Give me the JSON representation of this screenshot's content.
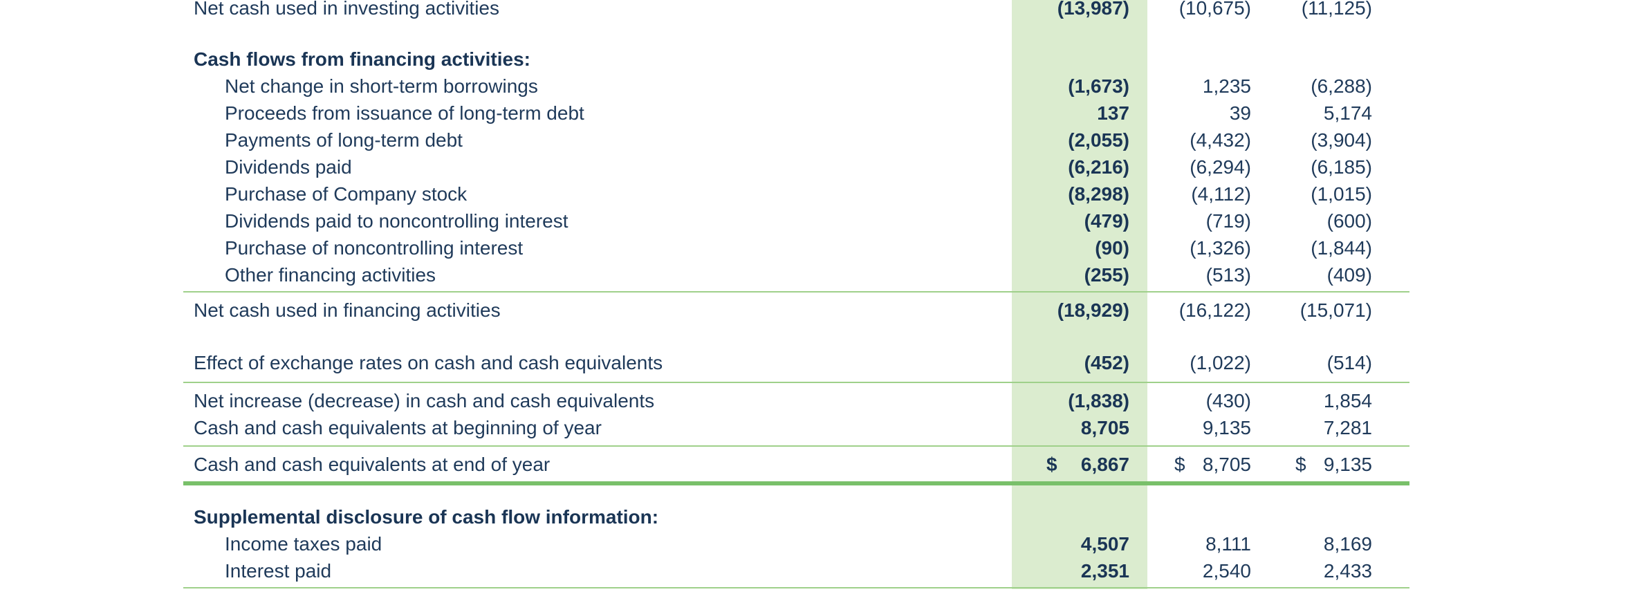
{
  "rows": [
    {
      "label": "Net cash used in investing activities",
      "c1": "(13,987)",
      "c2": "(10,675)",
      "c3": "(11,125)"
    },
    {
      "label": "Cash flows from financing activities:"
    },
    {
      "label": "Net change in short-term borrowings",
      "c1": "(1,673)",
      "c2": "1,235",
      "c3": "(6,288)"
    },
    {
      "label": "Proceeds from issuance of long-term debt",
      "c1": "137",
      "c2": "39",
      "c3": "5,174"
    },
    {
      "label": "Payments of long-term debt",
      "c1": "(2,055)",
      "c2": "(4,432)",
      "c3": "(3,904)"
    },
    {
      "label": "Dividends paid",
      "c1": "(6,216)",
      "c2": "(6,294)",
      "c3": "(6,185)"
    },
    {
      "label": "Purchase of Company stock",
      "c1": "(8,298)",
      "c2": "(4,112)",
      "c3": "(1,015)"
    },
    {
      "label": "Dividends paid to noncontrolling interest",
      "c1": "(479)",
      "c2": "(719)",
      "c3": "(600)"
    },
    {
      "label": "Purchase of noncontrolling interest",
      "c1": "(90)",
      "c2": "(1,326)",
      "c3": "(1,844)"
    },
    {
      "label": "Other financing activities",
      "c1": "(255)",
      "c2": "(513)",
      "c3": "(409)"
    },
    {
      "label": "Net cash used in financing activities",
      "c1": "(18,929)",
      "c2": "(16,122)",
      "c3": "(15,071)"
    },
    {
      "label": "Effect of exchange rates on cash and cash equivalents",
      "c1": "(452)",
      "c2": "(1,022)",
      "c3": "(514)"
    },
    {
      "label": "Net increase (decrease) in cash and cash equivalents",
      "c1": "(1,838)",
      "c2": "(430)",
      "c3": "1,854"
    },
    {
      "label": "Cash and cash equivalents at beginning of year",
      "c1": "8,705",
      "c2": "9,135",
      "c3": "7,281"
    },
    {
      "label": "Cash and cash equivalents at end of year",
      "c1": "6,867",
      "c2": "8,705",
      "c3": "9,135",
      "currency": "$"
    },
    {
      "label": "Supplemental disclosure of cash flow information:"
    },
    {
      "label": "Income taxes paid",
      "c1": "4,507",
      "c2": "8,111",
      "c3": "8,169"
    },
    {
      "label": "Interest paid",
      "c1": "2,351",
      "c2": "2,540",
      "c3": "2,433"
    }
  ],
  "colors": {
    "highlight": "#dbeccf",
    "rule": "#9fd08a",
    "text": "#1f3a5a"
  }
}
